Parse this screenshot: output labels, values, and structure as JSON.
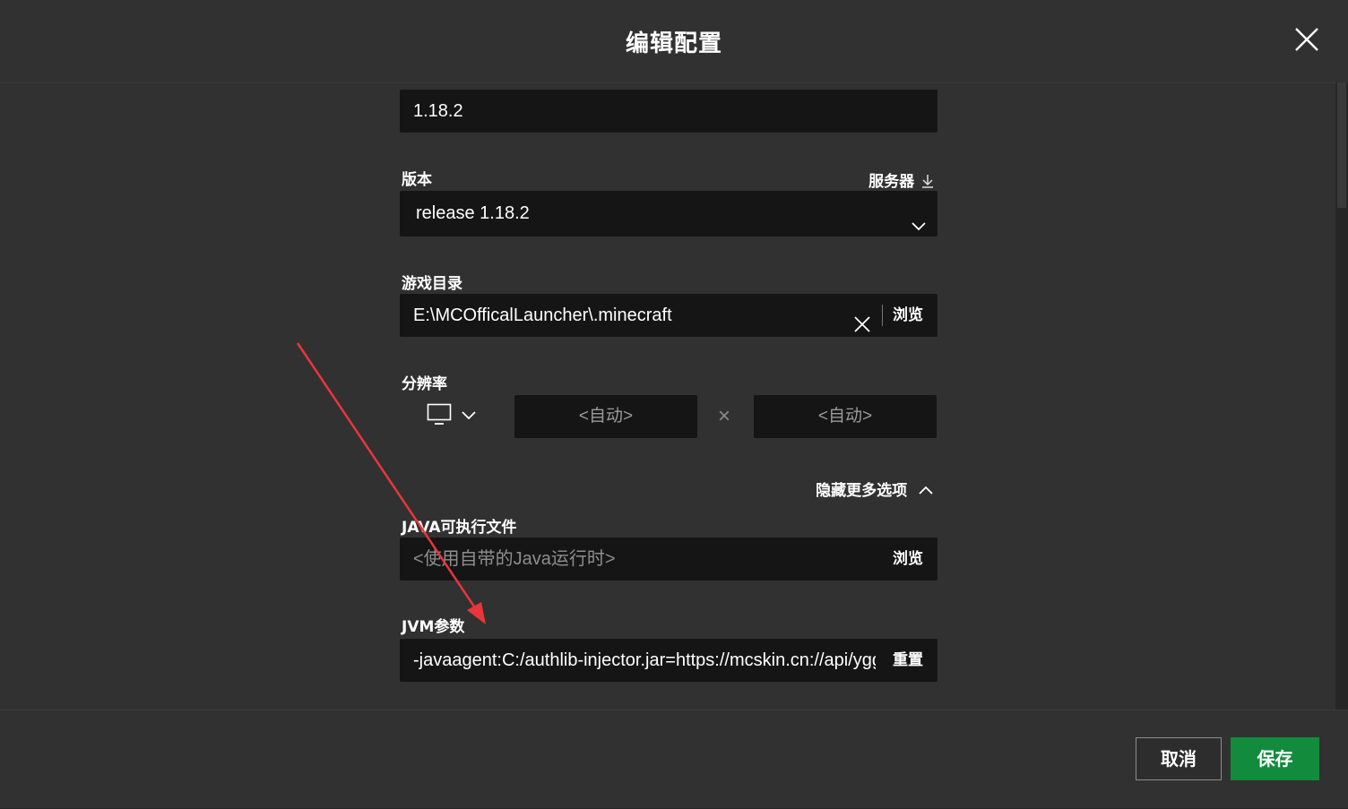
{
  "dialog": {
    "title": "编辑配置",
    "close_icon": "close-icon"
  },
  "fields": {
    "name_value": "1.18.2",
    "version": {
      "label": "版本",
      "server_link": "服务器",
      "server_icon": "download-arrow-icon",
      "value": "release 1.18.2",
      "dropdown_icon": "chevron-down-icon"
    },
    "game_dir": {
      "label": "游戏目录",
      "value": "E:\\MCOfficalLauncher\\.minecraft",
      "clear_icon": "clear-icon",
      "browse": "浏览"
    },
    "resolution": {
      "label": "分辨率",
      "monitor_icon": "monitor-icon",
      "width_placeholder": "<自动>",
      "height_placeholder": "<自动>",
      "separator": "×"
    },
    "more_options": {
      "toggle_label": "隐藏更多选项",
      "toggle_icon": "chevron-up-icon"
    },
    "java": {
      "label": "JAVA可执行文件",
      "placeholder": "<使用自带的Java运行时>",
      "browse": "浏览"
    },
    "jvm": {
      "label": "JVM参数",
      "value": "-javaagent:C:/authlib-injector.jar=https://mcskin.cn://api/yggc",
      "reset": "重置"
    }
  },
  "footer": {
    "cancel": "取消",
    "save": "保存"
  },
  "colors": {
    "background": "#313131",
    "input": "#151515",
    "save_button": "#128c3c",
    "annotation_arrow": "#e8363a"
  }
}
